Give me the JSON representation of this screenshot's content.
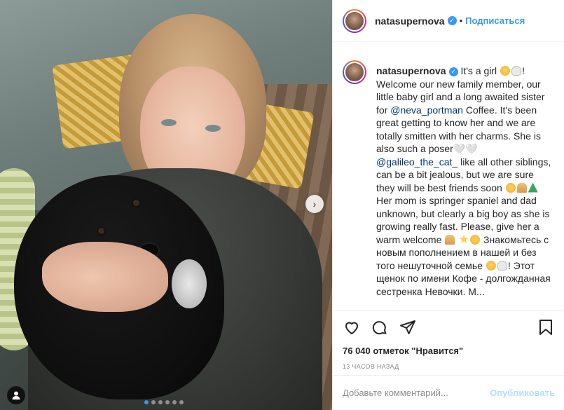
{
  "post": {
    "username": "natasupernova",
    "verified_icon": "verified-badge-icon",
    "separator": "•",
    "follow_label": "Подписаться"
  },
  "caption": {
    "username": "natasupernova",
    "t1": " It's a girl ",
    "t2": "! Welcome our new family member, our little baby girl and a long awaited sister for ",
    "mention1": "@neva_portman",
    "t3": " Coffee. It's been great getting to know her and we are totally smitten with her charms. She is also such a poser🤍🤍 ",
    "mention2": "@galileo_the_cat_",
    "t4": " like all other siblings, can be a bit jealous, but we are sure they will be best friends soon ",
    "t5": " Her mom is springer spaniel and dad unknown, but clearly a big boy as she is growing really fast. Please, give her a warm welcome ",
    "t6": " Знакомьтесь с новым пополнением в нашей и без того нешуточной семье ",
    "t7": "! Этот щенок по имени Кофе - долгожданная сестренка Невочки. М..."
  },
  "stats": {
    "likes": "76 040 отметок \"Нравится\"",
    "time": "13 ЧАСОВ НАЗАД"
  },
  "comment": {
    "placeholder": "Добавьте комментарий...",
    "post_label": "Опубликовать"
  },
  "carousel": {
    "count": 6,
    "active_index": 0
  },
  "colors": {
    "accent": "#3897f0",
    "post_disabled": "#b2dffc",
    "text": "#262626",
    "muted": "#8e8e8e"
  }
}
